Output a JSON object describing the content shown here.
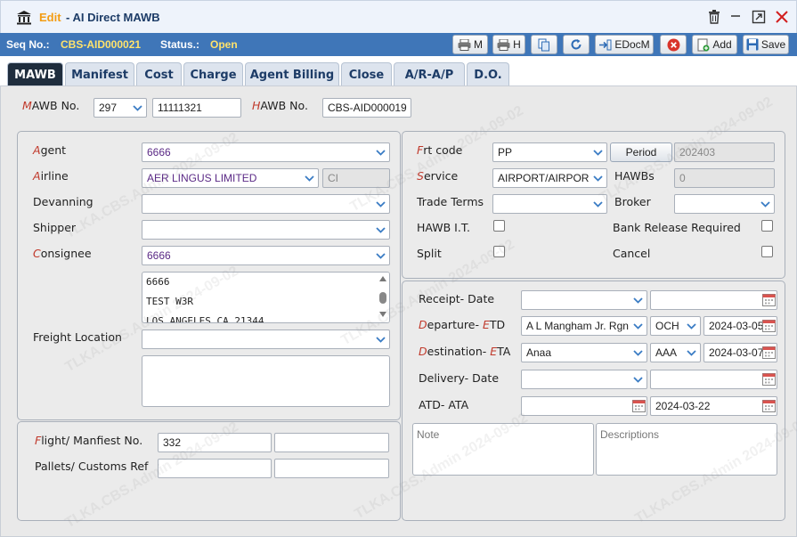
{
  "window": {
    "edit_label": "Edit",
    "title": "- AI Direct MAWB",
    "controls": [
      "delete",
      "minimize",
      "restore",
      "close"
    ]
  },
  "toolbar": {
    "seq_label": "Seq No.:",
    "seq_value": "CBS-AID000021",
    "status_label": "Status.:",
    "status_value": "Open",
    "buttons": {
      "print_m": "M",
      "print_h": "H",
      "edocm": "EDocM",
      "add": "Add",
      "save": "Save"
    }
  },
  "tabs": [
    "MAWB",
    "Manifest",
    "Cost",
    "Charge",
    "Agent Billing",
    "Close",
    "A/R-A/P",
    "D.O."
  ],
  "active_tab": "MAWB",
  "header": {
    "mawb_label_first": "M",
    "mawb_label_rest": "AWB No.",
    "mawb_prefix": "297",
    "mawb_number": "11111321",
    "hawb_label_first": "H",
    "hawb_label_rest": "AWB No.",
    "hawb_number": "CBS-AID000019"
  },
  "left": {
    "agent_label_first": "A",
    "agent_label_rest": "gent",
    "agent_value": "6666",
    "airline_label_first": "A",
    "airline_label_rest": "irline",
    "airline_value": "AER LINGUS LIMITED",
    "airline_code": "CI",
    "devanning_label": "Devanning",
    "devanning_value": "",
    "shipper_label": "Shipper",
    "shipper_value": "",
    "consignee_label_first": "C",
    "consignee_label_rest": "onsignee",
    "consignee_value": "6666",
    "consignee_address": [
      "6666",
      "TEST W3R",
      "LOS ANGELES CA 21344"
    ],
    "freight_location_label": "Freight Location",
    "freight_location_value": "",
    "freight_location_address": ""
  },
  "flight": {
    "flight_label_first": "F",
    "flight_label_rest": "light/ Manfiest No.",
    "flight_no": "332",
    "manifest_no": "",
    "pallets_label": "Pallets/ Customs Ref",
    "pallets": "",
    "customs_ref": ""
  },
  "right": {
    "frt_label_first": "F",
    "frt_label_rest": "rt code",
    "frt_value": "PP",
    "period_button": "Period",
    "period_value": "202403",
    "service_label_first": "S",
    "service_label_rest": "ervice",
    "service_value": "AIRPORT/AIRPOR",
    "hawbs_label": "HAWBs",
    "hawbs_value": "0",
    "trade_terms_label": "Trade Terms",
    "trade_terms_value": "",
    "broker_label": "Broker",
    "broker_value": "",
    "hawb_it_label": "HAWB I.T.",
    "bank_release_label": "Bank Release Required",
    "split_label": "Split",
    "cancel_label": "Cancel"
  },
  "dates": {
    "receipt_label": "Receipt- Date",
    "receipt_place": "",
    "receipt_date": "",
    "departure_label_first": "D",
    "departure_label_mid": "eparture- ",
    "departure_label_e": "E",
    "departure_label_rest": "TD",
    "departure_place": "A L Mangham Jr. Rgn",
    "departure_code": "OCH",
    "departure_date": "2024-03-05",
    "destination_label_first": "D",
    "destination_label_mid": "estination- ",
    "destination_label_e": "E",
    "destination_label_rest": "TA",
    "destination_place": "Anaa",
    "destination_code": "AAA",
    "destination_date": "2024-03-07",
    "delivery_label": "Delivery- Date",
    "delivery_place": "",
    "delivery_date": "",
    "atd_ata_label": "ATD- ATA",
    "atd": "",
    "ata": "2024-03-22"
  },
  "notes": {
    "note_placeholder": "Note",
    "descriptions_placeholder": "Descriptions"
  },
  "watermark": "TLKA.CBS.Admin 2024-09-02",
  "colors": {
    "toolbar_bg": "#3f76b8",
    "accent_yellow": "#ffe36b",
    "edit_orange": "#f39c12",
    "required_red": "#c0392b",
    "active_tab_bg": "#1f2d3d"
  }
}
